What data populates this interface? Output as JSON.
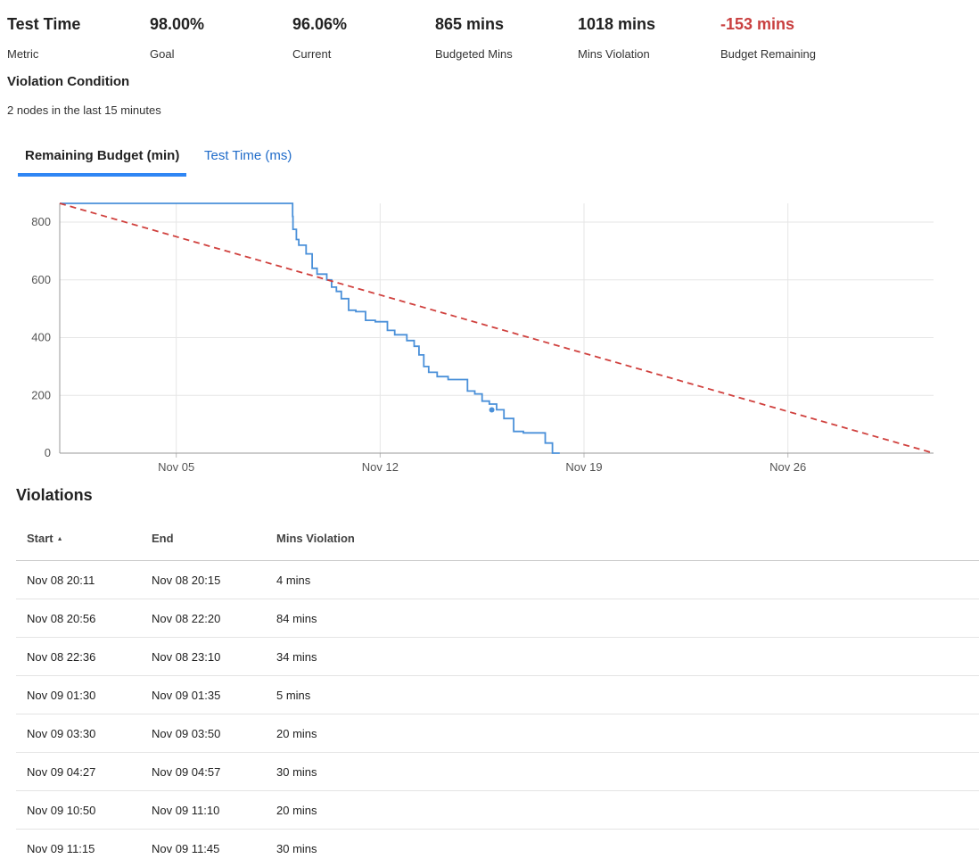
{
  "stats": [
    {
      "value": "Test Time",
      "label": "Metric",
      "negative": false
    },
    {
      "value": "98.00%",
      "label": "Goal",
      "negative": false
    },
    {
      "value": "96.06%",
      "label": "Current",
      "negative": false
    },
    {
      "value": "865 mins",
      "label": "Budgeted Mins",
      "negative": false
    },
    {
      "value": "1018 mins",
      "label": "Mins Violation",
      "negative": false
    },
    {
      "value": "-153 mins",
      "label": "Budget Remaining",
      "negative": true
    }
  ],
  "violation_condition": {
    "title": "Violation Condition",
    "text": "2 nodes in the last 15 minutes"
  },
  "tabs": [
    {
      "label": "Remaining Budget (min)",
      "active": true
    },
    {
      "label": "Test Time (ms)",
      "active": false
    }
  ],
  "chart_data": {
    "type": "line",
    "title": "",
    "xlabel": "",
    "ylabel": "",
    "x_ticks": [
      "Nov 05",
      "Nov 12",
      "Nov 19",
      "Nov 26"
    ],
    "y_ticks": [
      0,
      200,
      400,
      600,
      800
    ],
    "ylim": [
      0,
      865
    ],
    "xlim": [
      "Nov 01 00:00",
      "Nov 30 23:59"
    ],
    "grid": true,
    "legend": "none",
    "series": [
      {
        "style": "solid-step",
        "color": "#4a90d9",
        "points": [
          [
            "Nov 01 00:00",
            865
          ],
          [
            "Nov 08 23:50",
            865
          ],
          [
            "Nov 08 23:55",
            820
          ],
          [
            "Nov 09 00:10",
            775
          ],
          [
            "Nov 09 03:00",
            740
          ],
          [
            "Nov 09 05:00",
            720
          ],
          [
            "Nov 09 11:00",
            690
          ],
          [
            "Nov 09 16:00",
            640
          ],
          [
            "Nov 09 20:00",
            620
          ],
          [
            "Nov 10 04:00",
            600
          ],
          [
            "Nov 10 08:00",
            575
          ],
          [
            "Nov 10 12:00",
            560
          ],
          [
            "Nov 10 16:00",
            535
          ],
          [
            "Nov 10 22:00",
            495
          ],
          [
            "Nov 11 04:00",
            490
          ],
          [
            "Nov 11 12:00",
            460
          ],
          [
            "Nov 11 20:00",
            455
          ],
          [
            "Nov 12 06:00",
            425
          ],
          [
            "Nov 12 12:00",
            410
          ],
          [
            "Nov 12 22:00",
            390
          ],
          [
            "Nov 13 04:00",
            370
          ],
          [
            "Nov 13 08:00",
            340
          ],
          [
            "Nov 13 12:00",
            300
          ],
          [
            "Nov 13 16:00",
            280
          ],
          [
            "Nov 13 23:00",
            265
          ],
          [
            "Nov 14 08:00",
            255
          ],
          [
            "Nov 15 00:00",
            215
          ],
          [
            "Nov 15 06:00",
            205
          ],
          [
            "Nov 15 12:00",
            180
          ],
          [
            "Nov 15 18:00",
            170
          ],
          [
            "Nov 16 00:00",
            150
          ],
          [
            "Nov 16 06:00",
            120
          ],
          [
            "Nov 16 14:00",
            75
          ],
          [
            "Nov 16 22:00",
            70
          ],
          [
            "Nov 17 16:00",
            35
          ],
          [
            "Nov 17 22:00",
            0
          ],
          [
            "Nov 18 04:00",
            0
          ]
        ]
      },
      {
        "style": "dashed",
        "color": "#d0413e",
        "points": [
          [
            "Nov 01 00:00",
            865
          ],
          [
            "Nov 30 23:59",
            0
          ]
        ]
      }
    ],
    "marker": {
      "x": "Nov 15 20:00",
      "y": 150
    }
  },
  "violations": {
    "title": "Violations",
    "columns": [
      "Start",
      "End",
      "Mins Violation"
    ],
    "sort_icon": "sort-ascending-icon",
    "rows": [
      [
        "Nov 08 20:11",
        "Nov 08 20:15",
        "4 mins"
      ],
      [
        "Nov 08 20:56",
        "Nov 08 22:20",
        "84 mins"
      ],
      [
        "Nov 08 22:36",
        "Nov 08 23:10",
        "34 mins"
      ],
      [
        "Nov 09 01:30",
        "Nov 09 01:35",
        "5 mins"
      ],
      [
        "Nov 09 03:30",
        "Nov 09 03:50",
        "20 mins"
      ],
      [
        "Nov 09 04:27",
        "Nov 09 04:57",
        "30 mins"
      ],
      [
        "Nov 09 10:50",
        "Nov 09 11:10",
        "20 mins"
      ],
      [
        "Nov 09 11:15",
        "Nov 09 11:45",
        "30 mins"
      ]
    ]
  }
}
